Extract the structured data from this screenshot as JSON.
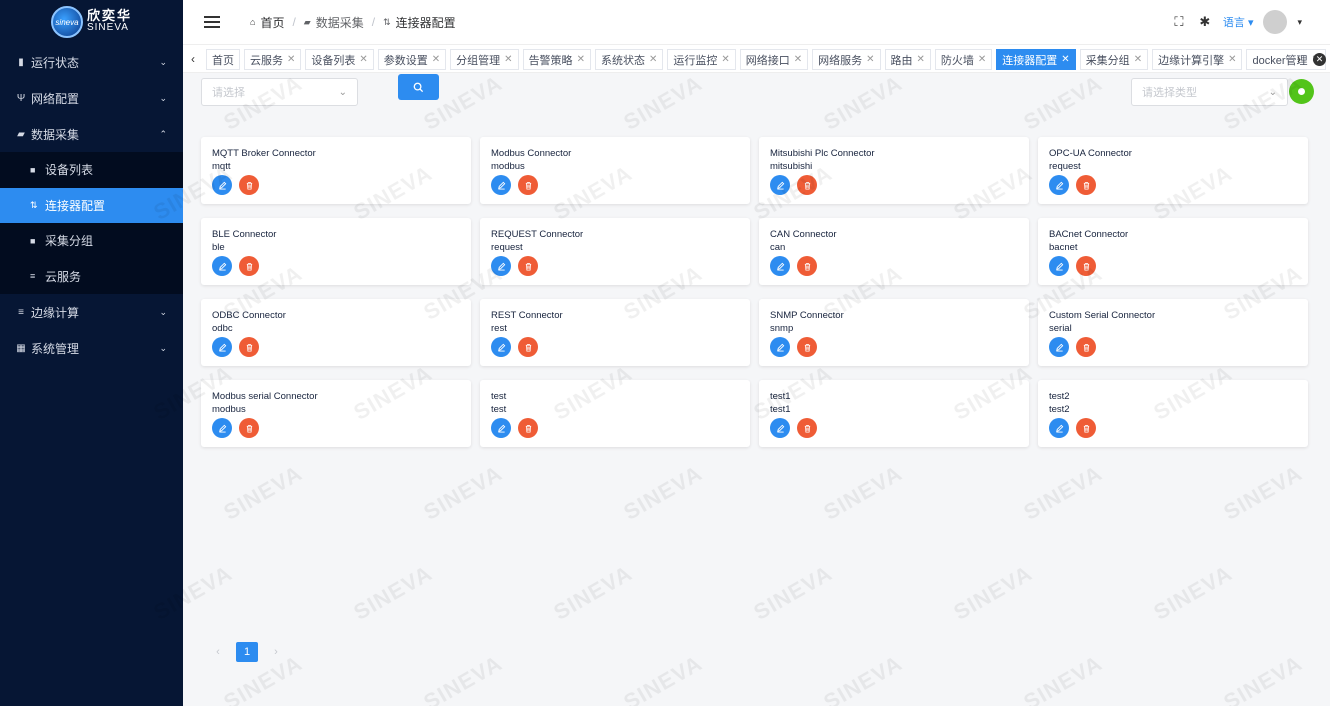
{
  "logo": {
    "cn": "欣奕华",
    "en": "SINEVA",
    "badge": "sineva"
  },
  "sidebar": {
    "menu": [
      {
        "label": "运行状态",
        "icon": "bar-chart-icon",
        "glyph": "▮",
        "expanded": false
      },
      {
        "label": "网络配置",
        "icon": "network-icon",
        "glyph": "Ψ",
        "expanded": false
      },
      {
        "label": "数据采集",
        "icon": "data-collect-icon",
        "glyph": "▰",
        "expanded": true
      },
      {
        "label": "边缘计算",
        "icon": "list-icon",
        "glyph": "≡",
        "expanded": false
      },
      {
        "label": "系统管理",
        "icon": "windows-icon",
        "glyph": "▦",
        "expanded": false
      }
    ],
    "submenu": [
      {
        "label": "设备列表",
        "icon": "device-list-icon",
        "glyph": "■"
      },
      {
        "label": "连接器配置",
        "icon": "connector-icon",
        "glyph": "⇅",
        "active": true
      },
      {
        "label": "采集分组",
        "icon": "group-icon",
        "glyph": "■"
      },
      {
        "label": "云服务",
        "icon": "cloud-icon",
        "glyph": "≡"
      }
    ]
  },
  "header": {
    "breadcrumb": [
      "首页",
      "数据采集",
      "连接器配置"
    ],
    "language": "语言"
  },
  "tabs": [
    {
      "label": "首页",
      "closable": false
    },
    {
      "label": "云服务",
      "closable": true
    },
    {
      "label": "设备列表",
      "closable": true
    },
    {
      "label": "参数设置",
      "closable": true
    },
    {
      "label": "分组管理",
      "closable": true
    },
    {
      "label": "告警策略",
      "closable": true
    },
    {
      "label": "系统状态",
      "closable": true
    },
    {
      "label": "运行监控",
      "closable": true
    },
    {
      "label": "网络接口",
      "closable": true
    },
    {
      "label": "网络服务",
      "closable": true
    },
    {
      "label": "路由",
      "closable": true
    },
    {
      "label": "防火墙",
      "closable": true
    },
    {
      "label": "连接器配置",
      "closable": true,
      "active": true
    },
    {
      "label": "采集分组",
      "closable": true
    },
    {
      "label": "边缘计算引擎",
      "closable": true
    },
    {
      "label": "docker管理",
      "closable": true
    }
  ],
  "filter": {
    "select_placeholder": "请选择",
    "type_placeholder": "请选择类型"
  },
  "connectors": [
    {
      "name": "MQTT Broker Connector",
      "type": "mqtt"
    },
    {
      "name": "Modbus Connector",
      "type": "modbus"
    },
    {
      "name": "Mitsubishi Plc Connector",
      "type": "mitsubishi"
    },
    {
      "name": "OPC-UA Connector",
      "type": "request"
    },
    {
      "name": "BLE Connector",
      "type": "ble"
    },
    {
      "name": "REQUEST Connector",
      "type": "request"
    },
    {
      "name": "CAN Connector",
      "type": "can"
    },
    {
      "name": "BACnet Connector",
      "type": "bacnet"
    },
    {
      "name": "ODBC Connector",
      "type": "odbc"
    },
    {
      "name": "REST Connector",
      "type": "rest"
    },
    {
      "name": "SNMP Connector",
      "type": "snmp"
    },
    {
      "name": "Custom Serial Connector",
      "type": "serial"
    },
    {
      "name": "Modbus serial Connector",
      "type": "modbus"
    },
    {
      "name": "test",
      "type": "test"
    },
    {
      "name": "test1",
      "type": "test1"
    },
    {
      "name": "test2",
      "type": "test2"
    }
  ],
  "pagination": {
    "current": "1"
  },
  "watermark": "SINEVA",
  "colors": {
    "primary": "#2d8cf0",
    "danger": "#ed4014",
    "success": "#52c41a",
    "sidebar": "#061634"
  }
}
